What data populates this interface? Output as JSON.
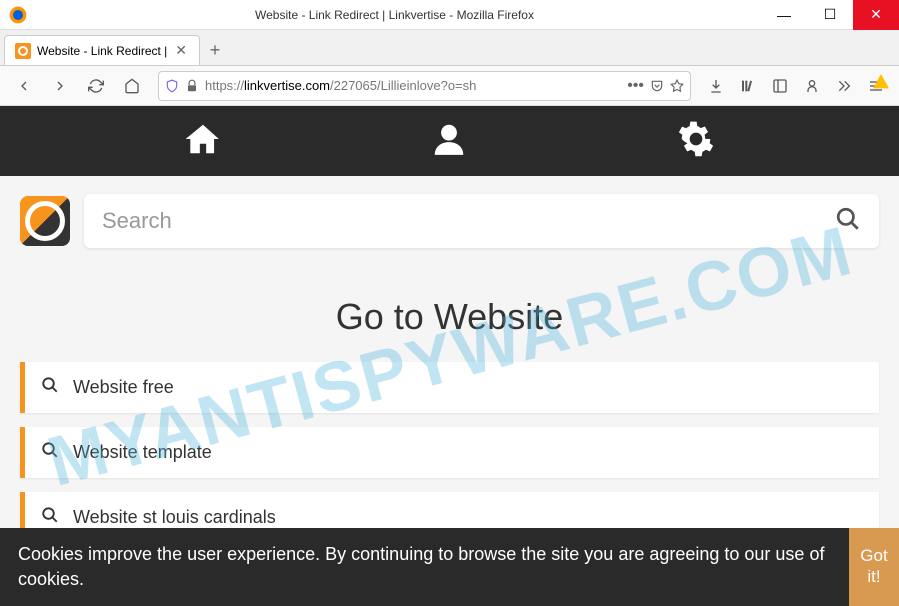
{
  "window": {
    "title": "Website - Link Redirect | Linkvertise - Mozilla Firefox"
  },
  "tab": {
    "title": "Website - Link Redirect |"
  },
  "url": {
    "prefix": "https://",
    "domain": "linkvertise.com",
    "path": "/227065/Lillieinlove?o=sh"
  },
  "search": {
    "placeholder": "Search"
  },
  "heading": "Go to Website",
  "results": [
    {
      "label": "Website free"
    },
    {
      "label": "Website template"
    },
    {
      "label": "Website st louis cardinals"
    }
  ],
  "cookie": {
    "text": "Cookies improve the user experience. By continuing to browse the site you are agreeing to our use of cookies.",
    "button": "Got it!"
  },
  "watermark": "MYANTISPYWARE.COM"
}
